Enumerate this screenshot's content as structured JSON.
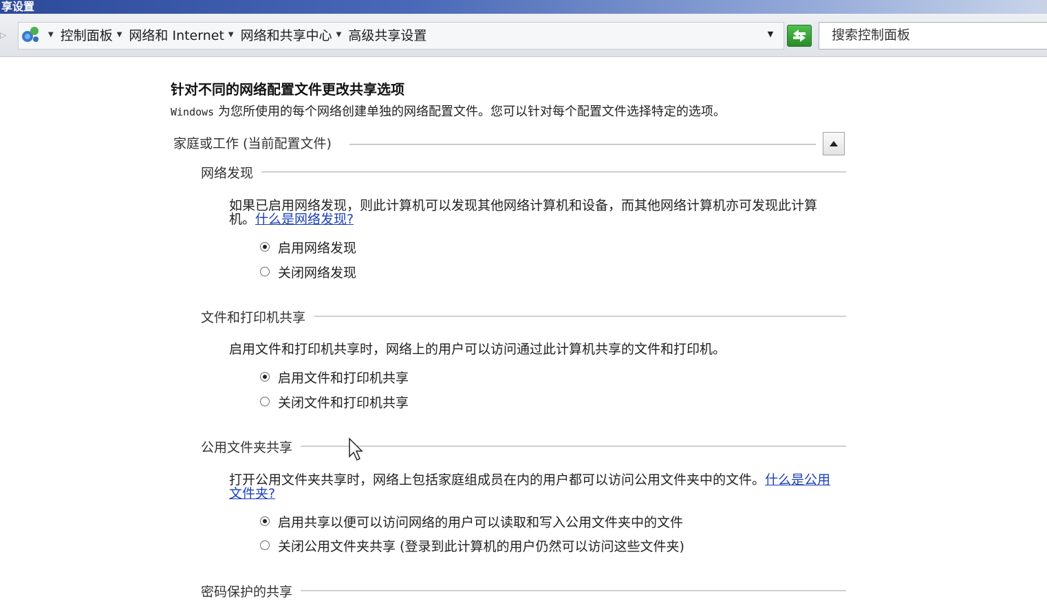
{
  "window": {
    "title": "享设置"
  },
  "breadcrumb": {
    "items": [
      "控制面板",
      "网络和 Internet",
      "网络和共享中心",
      "高级共享设置"
    ]
  },
  "search": {
    "placeholder": "搜索控制面板"
  },
  "page": {
    "heading": "针对不同的网络配置文件更改共享选项",
    "subtitle_prefix": "Windows",
    "subtitle_rest": " 为您所使用的每个网络创建单独的网络配置文件。您可以针对每个配置文件选择特定的选项。",
    "profile_label": "家庭或工作 (当前配置文件)"
  },
  "sections": {
    "discovery": {
      "title": "网络发现",
      "description": "如果已启用网络发现，则此计算机可以发现其他网络计算机和设备，而其他网络计算机亦可发现此计算机。",
      "link": "什么是网络发现?",
      "options": [
        "启用网络发现",
        "关闭网络发现"
      ],
      "selected_index": 0
    },
    "file_print": {
      "title": "文件和打印机共享",
      "description": "启用文件和打印机共享时，网络上的用户可以访问通过此计算机共享的文件和打印机。",
      "options": [
        "启用文件和打印机共享",
        "关闭文件和打印机共享"
      ],
      "selected_index": 0
    },
    "public_folder": {
      "title": "公用文件夹共享",
      "description": "打开公用文件夹共享时，网络上包括家庭组成员在内的用户都可以访问公用文件夹中的文件。",
      "link": "什么是公用文件夹?",
      "options": [
        "启用共享以便可以访问网络的用户可以读取和写入公用文件夹中的文件",
        "关闭公用文件夹共享 (登录到此计算机的用户仍然可以访问这些文件夹)"
      ],
      "selected_index": 0
    },
    "password": {
      "title": "密码保护的共享"
    }
  },
  "colors": {
    "link": "#1a3fb8",
    "titlebar": "#2d4a9a"
  }
}
